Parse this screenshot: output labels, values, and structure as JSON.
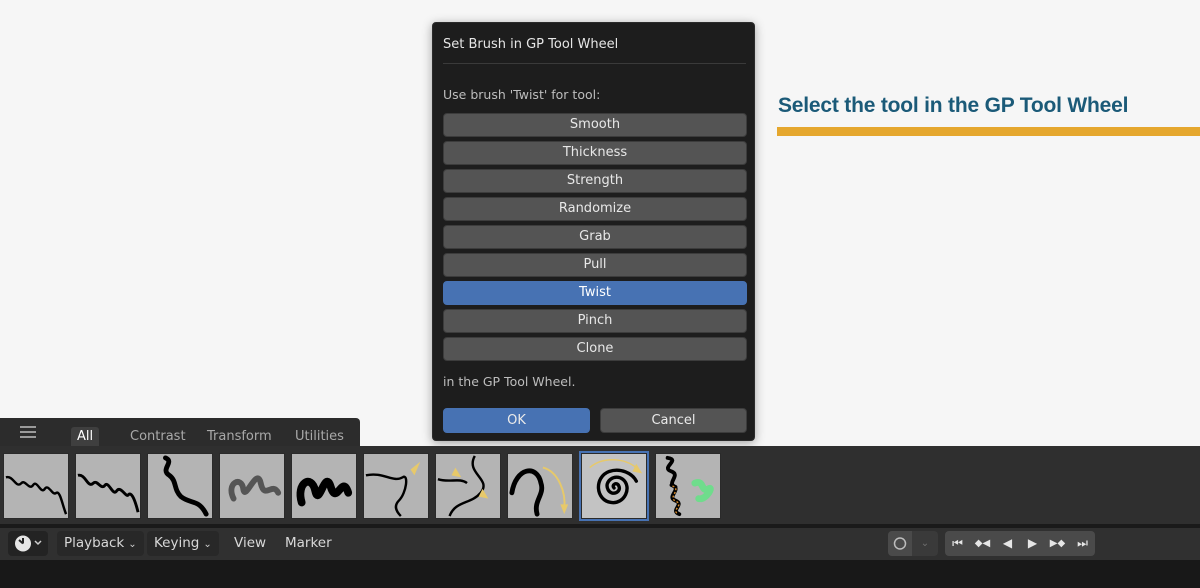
{
  "callout": {
    "title": "Select the tool in the GP Tool Wheel",
    "accent_color": "#e5a72e",
    "title_color": "#1b5a78"
  },
  "dialog": {
    "title": "Set Brush in GP Tool Wheel",
    "prompt": "Use brush 'Twist' for tool:",
    "tools": [
      {
        "label": "Smooth",
        "selected": false
      },
      {
        "label": "Thickness",
        "selected": false
      },
      {
        "label": "Strength",
        "selected": false
      },
      {
        "label": "Randomize",
        "selected": false
      },
      {
        "label": "Grab",
        "selected": false
      },
      {
        "label": "Pull",
        "selected": false
      },
      {
        "label": "Twist",
        "selected": true
      },
      {
        "label": "Pinch",
        "selected": false
      },
      {
        "label": "Clone",
        "selected": false
      }
    ],
    "suffix": "in the GP Tool Wheel.",
    "ok_label": "OK",
    "cancel_label": "Cancel",
    "accent_color": "#4772b3"
  },
  "asset_shelf": {
    "menu_icon": "hamburger-icon",
    "tabs": [
      {
        "label": "All",
        "active": true
      },
      {
        "label": "Contrast",
        "active": false
      },
      {
        "label": "Transform",
        "active": false
      },
      {
        "label": "Utilities",
        "active": false
      }
    ],
    "brushes": [
      {
        "icon": "smooth-brush-icon",
        "selected": false
      },
      {
        "icon": "thickness-brush-icon",
        "selected": false
      },
      {
        "icon": "strength-brush-icon",
        "selected": false
      },
      {
        "icon": "randomize-brush-icon",
        "selected": false
      },
      {
        "icon": "grab-brush-icon",
        "selected": false
      },
      {
        "icon": "pull-brush-icon",
        "selected": false
      },
      {
        "icon": "pinch-brush-icon",
        "selected": false
      },
      {
        "icon": "push-brush-icon",
        "selected": false
      },
      {
        "icon": "twist-brush-icon",
        "selected": true
      },
      {
        "icon": "clone-brush-icon",
        "selected": false
      }
    ]
  },
  "timeline_header": {
    "editor_icon": "clock-icon",
    "menus": [
      {
        "label": "Playback",
        "dropdown": true
      },
      {
        "label": "Keying",
        "dropdown": true
      },
      {
        "label": "View",
        "dropdown": false
      },
      {
        "label": "Marker",
        "dropdown": false
      }
    ],
    "snap_icon": "circle-icon",
    "playback_controls": [
      {
        "icon": "jump-to-start-icon",
        "glyph": "⏮"
      },
      {
        "icon": "previous-keyframe-icon",
        "glyph": "◆◀"
      },
      {
        "icon": "play-reverse-icon",
        "glyph": "◀"
      },
      {
        "icon": "play-icon",
        "glyph": "▶"
      },
      {
        "icon": "next-keyframe-icon",
        "glyph": "▶◆"
      },
      {
        "icon": "jump-to-end-icon",
        "glyph": "⏭"
      }
    ]
  }
}
